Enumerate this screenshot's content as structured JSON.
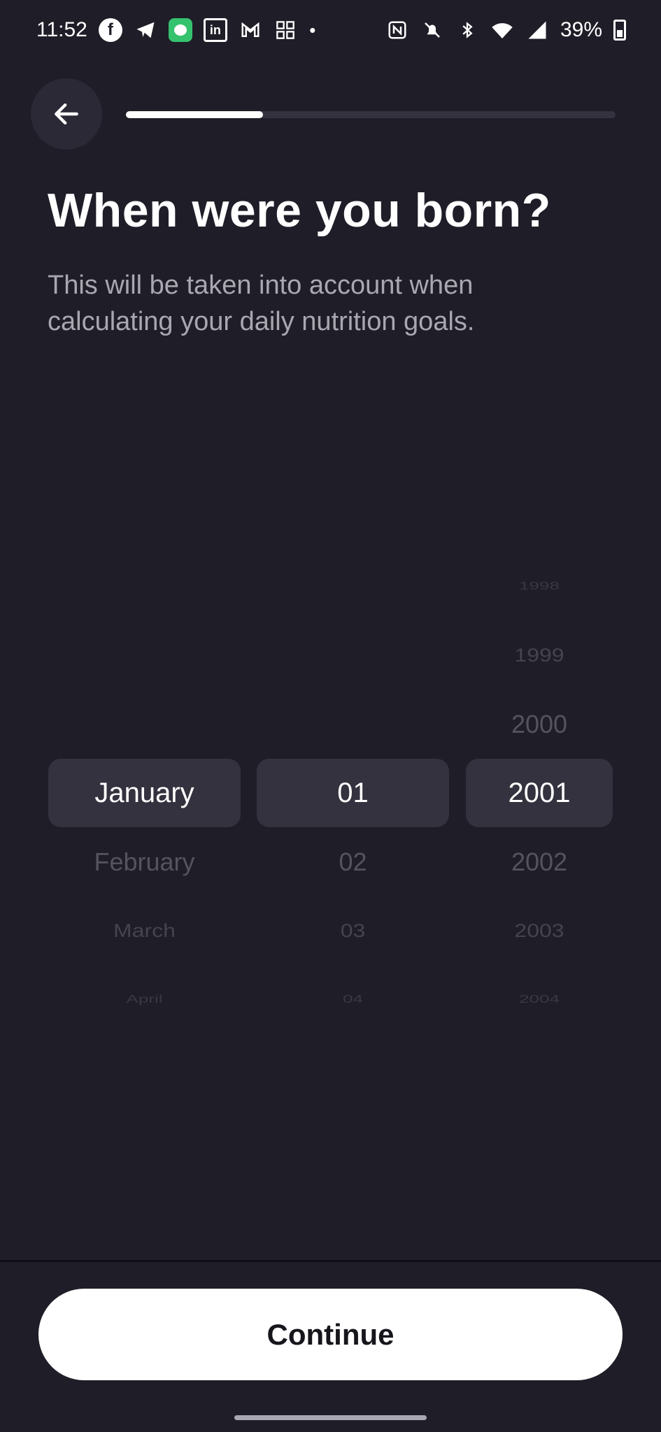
{
  "status_bar": {
    "time": "11:52",
    "battery_percent": "39%",
    "icons_left": [
      "facebook-icon",
      "telegram-icon",
      "chat-app-icon",
      "linkedin-icon",
      "gmail-icon",
      "qr-app-icon",
      "dot-icon"
    ],
    "icons_right": [
      "nfc-icon",
      "bell-off-icon",
      "bluetooth-icon",
      "wifi-icon",
      "signal-icon",
      "battery-icon"
    ]
  },
  "header": {
    "back_icon": "arrow-left-icon",
    "progress_fraction": 0.28
  },
  "content": {
    "title": "When were you born?",
    "subtitle": "This will be taken into account when calculating your daily nutrition goals."
  },
  "picker": {
    "month": {
      "selected": "January",
      "after": [
        "February",
        "March",
        "April"
      ]
    },
    "day": {
      "selected": "01",
      "after": [
        "02",
        "03",
        "04"
      ]
    },
    "year": {
      "before": [
        "1998",
        "1999",
        "2000"
      ],
      "selected": "2001",
      "after": [
        "2002",
        "2003",
        "2004"
      ]
    }
  },
  "footer": {
    "continue_label": "Continue"
  },
  "colors": {
    "background": "#1f1d27",
    "selected_pill": "#34323e",
    "button_bg": "#ffffff",
    "button_text": "#17161c"
  }
}
